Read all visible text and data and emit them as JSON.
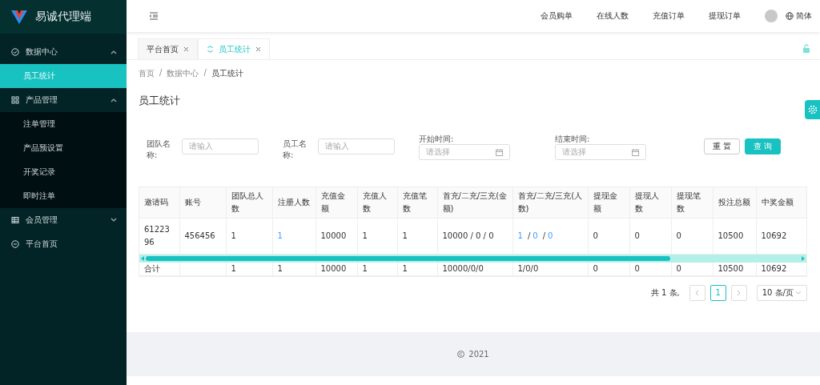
{
  "sidebar": {
    "logo_text": "易诚代理端",
    "menu": [
      {
        "label": "数据中心",
        "expanded": true,
        "children": [
          {
            "label": "员工统计",
            "selected": true
          }
        ]
      },
      {
        "label": "产品管理",
        "expanded": true,
        "children": [
          {
            "label": "注单管理",
            "selected": false
          },
          {
            "label": "产品预设置",
            "selected": false
          },
          {
            "label": "开奖记录",
            "selected": false
          },
          {
            "label": "即时注单",
            "selected": false
          }
        ]
      },
      {
        "label": "会员管理",
        "expanded": false
      },
      {
        "label": "平台首页"
      }
    ]
  },
  "header": {
    "links": [
      "会员购单",
      "在线人数",
      "充值订单",
      "提现订单"
    ],
    "language": "简体"
  },
  "tabs": [
    {
      "label": "平台首页",
      "selected": false
    },
    {
      "label": "员工统计",
      "selected": true
    }
  ],
  "breadcrumb": [
    {
      "kind": "link",
      "label": "首页"
    },
    {
      "kind": "separator",
      "label": "/"
    },
    {
      "kind": "link",
      "label": "数据中心"
    },
    {
      "kind": "separator",
      "label": "/"
    },
    {
      "kind": "current",
      "label": "员工统计"
    }
  ],
  "page_title": "员工统计",
  "filters": [
    {
      "label": "团队名称:",
      "placeholder": "请输入",
      "kind": "text"
    },
    {
      "label": "员工名称:",
      "placeholder": "请输入",
      "kind": "text"
    },
    {
      "label": "开始时间:",
      "placeholder": "请选择",
      "kind": "date"
    },
    {
      "label": "结束时间:",
      "placeholder": "请选择",
      "kind": "date"
    }
  ],
  "buttons": [
    {
      "label": "重 置",
      "kind": "default"
    },
    {
      "label": "查 询",
      "kind": "primary"
    }
  ],
  "table": {
    "columns": [
      "邀请码",
      "账号",
      "团队总人数",
      "注册人数",
      "充值金额",
      "充值人数",
      "充值笔数",
      "首充/二充/三充(金额)",
      "首充/二充/三充(人数)",
      "提现金额",
      "提现人数",
      "提现笔数",
      "投注总额",
      "中奖金额"
    ],
    "rows": [
      [
        {
          "text": "6122396"
        },
        {
          "text": "456456"
        },
        {
          "text": "1"
        },
        {
          "link": "1"
        },
        {
          "text": "10000"
        },
        {
          "text": "1"
        },
        {
          "text": "1"
        },
        {
          "text": "10000 / 0 / 0"
        },
        {
          "links": [
            "1",
            "/",
            "0",
            "/",
            "0"
          ]
        },
        {
          "text": "0"
        },
        {
          "text": "0"
        },
        {
          "text": "0"
        },
        {
          "text": "10500"
        },
        {
          "text": "10692"
        }
      ]
    ],
    "total_row": {
      "label": "合计",
      "cells": [
        "1",
        "1",
        "10000",
        "1",
        "1",
        "10000/0/0",
        "1/0/0",
        "0",
        "0",
        "0",
        "10500",
        "10692"
      ]
    }
  },
  "pagination": {
    "total": "共 1 条,",
    "pages": [
      {
        "label": "1",
        "selected": true
      }
    ],
    "page_size": "10 条/页"
  },
  "footer": {
    "year": "2021"
  }
}
